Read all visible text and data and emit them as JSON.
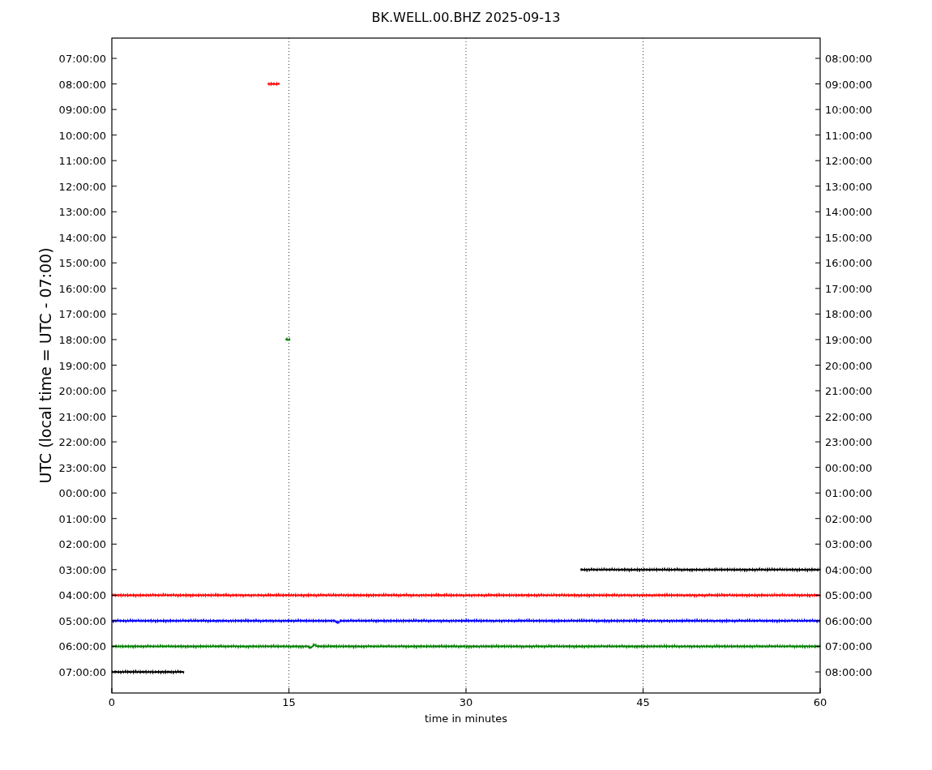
{
  "title": "BK.WELL.00.BHZ 2025-09-13",
  "ylabel": "UTC (local time = UTC - 07:00)",
  "xlabel": "time in minutes",
  "xticks": [
    "0",
    "15",
    "30",
    "45",
    "60"
  ],
  "left_ticks": [
    "07:00:00",
    "08:00:00",
    "09:00:00",
    "10:00:00",
    "11:00:00",
    "12:00:00",
    "13:00:00",
    "14:00:00",
    "15:00:00",
    "16:00:00",
    "17:00:00",
    "18:00:00",
    "19:00:00",
    "20:00:00",
    "21:00:00",
    "22:00:00",
    "23:00:00",
    "00:00:00",
    "01:00:00",
    "02:00:00",
    "03:00:00",
    "04:00:00",
    "05:00:00",
    "06:00:00",
    "07:00:00"
  ],
  "right_ticks": [
    "08:00:00",
    "09:00:00",
    "10:00:00",
    "11:00:00",
    "12:00:00",
    "13:00:00",
    "14:00:00",
    "15:00:00",
    "16:00:00",
    "17:00:00",
    "18:00:00",
    "19:00:00",
    "20:00:00",
    "21:00:00",
    "22:00:00",
    "23:00:00",
    "00:00:00",
    "01:00:00",
    "02:00:00",
    "03:00:00",
    "04:00:00",
    "05:00:00",
    "06:00:00",
    "07:00:00",
    "08:00:00"
  ]
}
